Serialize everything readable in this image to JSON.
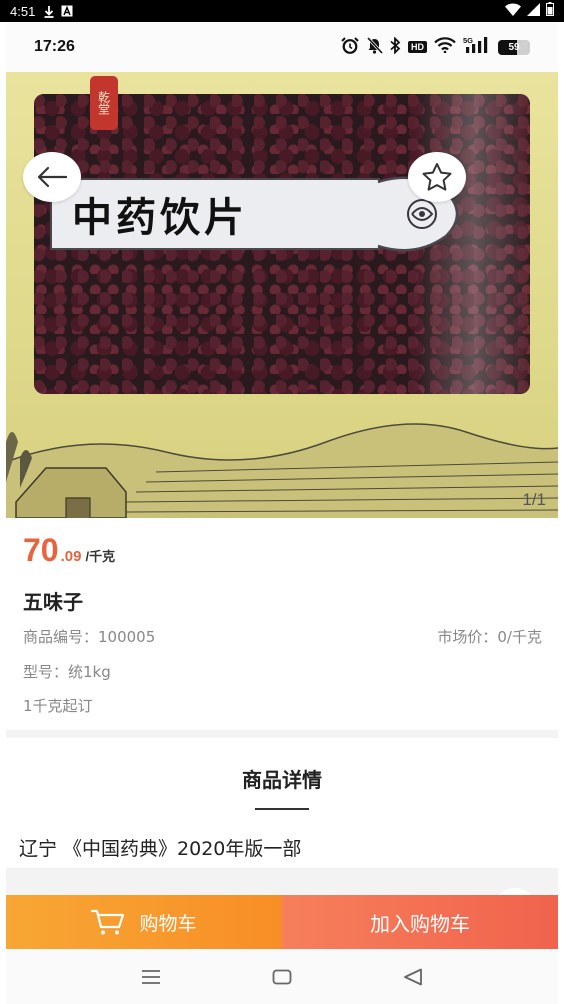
{
  "system_bar": {
    "time": "4:51",
    "icons": [
      "download-icon",
      "a-badge-icon",
      "wifi-icon",
      "signal-icon",
      "battery-icon"
    ]
  },
  "status_bar": {
    "time": "17:26",
    "hd_label": "HD",
    "network": "5G",
    "battery_level": "59"
  },
  "hero": {
    "package_label": "中药饮片",
    "brand_seal": "乾堂",
    "image_counter": "1/1",
    "icons": [
      "back-arrow-icon",
      "star-icon"
    ]
  },
  "product": {
    "price_int": "70",
    "price_dec": ".09",
    "price_unit": "/千克",
    "name": "五味子",
    "code": "商品编号：100005",
    "market_price": "市场价：0/千克",
    "model": "型号：统1kg",
    "moq": "1千克起订"
  },
  "detail": {
    "title": "商品详情",
    "text": "辽宁 《中国药典》2020年版一部"
  },
  "actions": {
    "cart_label": "购物车",
    "add_label": "加入购物车",
    "colors": {
      "cart": "#f89a2e",
      "add": "#f3684f",
      "price": "#e8643c"
    }
  },
  "nav": {
    "icons": [
      "menu-icon",
      "home-icon",
      "back-triangle-icon"
    ]
  }
}
